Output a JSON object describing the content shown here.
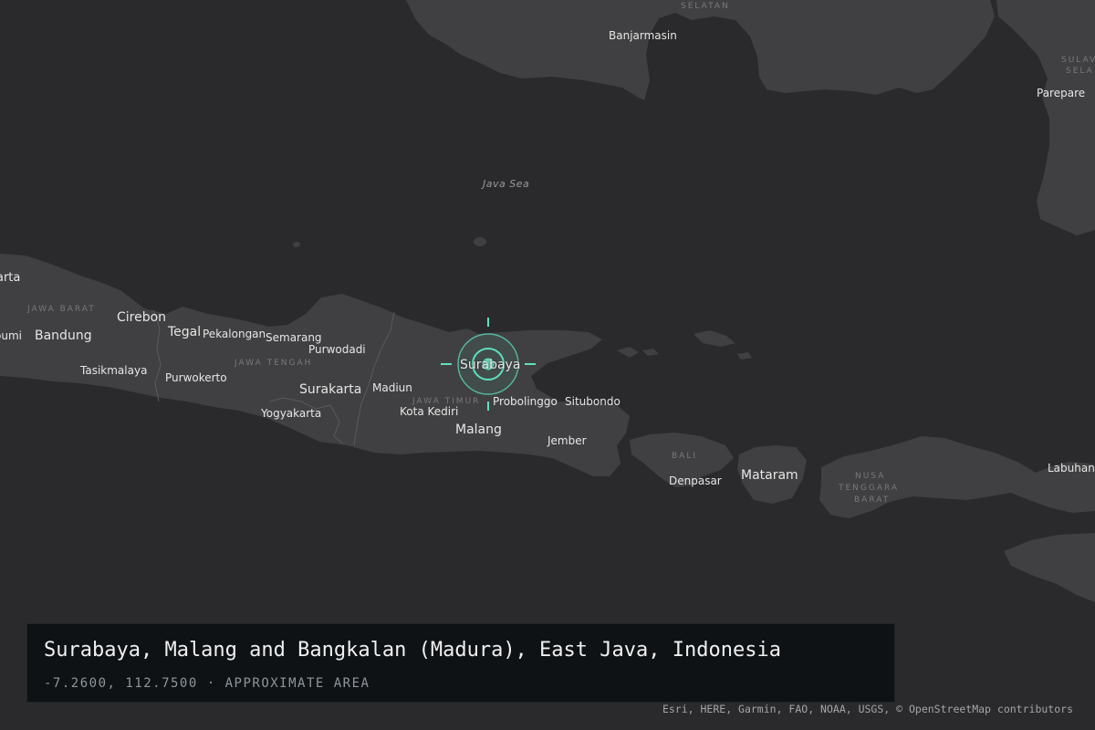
{
  "map": {
    "basemap": "dark-gray-canvas",
    "colors": {
      "water": "#2a2a2c",
      "land": "#404042",
      "accent": "#5ee0bf",
      "panel": "#0e1215"
    },
    "marker": {
      "icon": "crosshair-target-icon",
      "label": "Surabaya"
    },
    "labels": {
      "cities": [
        "Banjarmasin",
        "Parepare",
        "Cirebon",
        "Bandung",
        "Tegal",
        "Pekalongan",
        "Semarang",
        "Purwodadi",
        "Tasikmalaya",
        "Purwokerto",
        "Surakarta",
        "Madiun",
        "Yogyakarta",
        "Kota Kediri",
        "Malang",
        "Probolinggo",
        "Situbondo",
        "Jember",
        "Denpasar",
        "Mataram",
        "Labuhanb",
        "arta",
        "oumi"
      ],
      "regions": [
        "SELATAN",
        "SULAV",
        "SELA",
        "JAWA BARAT",
        "JAWA TENGAH",
        "JAWA TIMUR",
        "BALI",
        "NUSA",
        "TENGGARA",
        "BARAT"
      ],
      "water": [
        "Java Sea"
      ]
    }
  },
  "info_panel": {
    "title": "Surabaya, Malang and Bangkalan (Madura), East Java, Indonesia",
    "coordinates": "-7.2600, 112.7500",
    "separator": "·",
    "precision": "APPROXIMATE AREA"
  },
  "attribution": "Esri, HERE, Garmin, FAO, NOAA, USGS, © OpenStreetMap contributors"
}
